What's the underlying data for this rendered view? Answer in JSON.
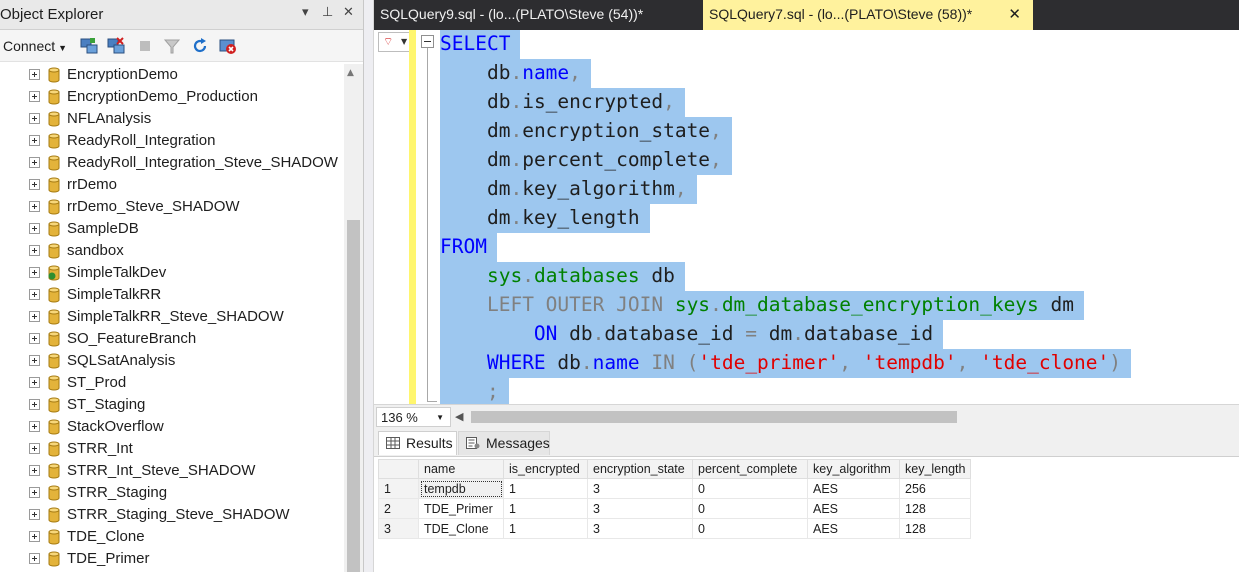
{
  "object_explorer": {
    "title": "Object Explorer",
    "controls": {
      "pin": "▾",
      "autohide": "⊥",
      "close": "✕"
    },
    "toolbar": {
      "connect_label": "Connect",
      "icons": [
        "connect-icon",
        "disconnect-icon",
        "stop-icon",
        "filter-icon",
        "refresh-icon",
        "activity-monitor-icon"
      ]
    },
    "databases": [
      {
        "name": "EncryptionDemo"
      },
      {
        "name": "EncryptionDemo_Production"
      },
      {
        "name": "NFLAnalysis"
      },
      {
        "name": "ReadyRoll_Integration"
      },
      {
        "name": "ReadyRoll_Integration_Steve_SHADOW"
      },
      {
        "name": "rrDemo"
      },
      {
        "name": "rrDemo_Steve_SHADOW"
      },
      {
        "name": "SampleDB"
      },
      {
        "name": "sandbox"
      },
      {
        "name": "SimpleTalkDev",
        "special": true
      },
      {
        "name": "SimpleTalkRR"
      },
      {
        "name": "SimpleTalkRR_Steve_SHADOW"
      },
      {
        "name": "SO_FeatureBranch"
      },
      {
        "name": "SQLSatAnalysis"
      },
      {
        "name": "ST_Prod"
      },
      {
        "name": "ST_Staging"
      },
      {
        "name": "StackOverflow"
      },
      {
        "name": "STRR_Int"
      },
      {
        "name": "STRR_Int_Steve_SHADOW"
      },
      {
        "name": "STRR_Staging"
      },
      {
        "name": "STRR_Staging_Steve_SHADOW"
      },
      {
        "name": "TDE_Clone"
      },
      {
        "name": "TDE_Primer"
      }
    ]
  },
  "tabs": [
    {
      "label": "SQLQuery9.sql - (lo...(PLATO\\Steve (54))*",
      "active": false
    },
    {
      "label": "SQLQuery7.sql - (lo...(PLATO\\Steve (58))*",
      "active": true,
      "close": "✕"
    }
  ],
  "editor": {
    "lines": [
      [
        {
          "t": "SELECT",
          "c": "kw"
        }
      ],
      [
        {
          "t": "    db"
        },
        {
          "t": ".",
          "c": "gr"
        },
        {
          "t": "name",
          "c": "kw"
        },
        {
          "t": ",",
          "c": "gr"
        }
      ],
      [
        {
          "t": "    db"
        },
        {
          "t": ".",
          "c": "gr"
        },
        {
          "t": "is_encrypted"
        },
        {
          "t": ",",
          "c": "gr"
        }
      ],
      [
        {
          "t": "    dm"
        },
        {
          "t": ".",
          "c": "gr"
        },
        {
          "t": "encryption_state"
        },
        {
          "t": ",",
          "c": "gr"
        }
      ],
      [
        {
          "t": "    dm"
        },
        {
          "t": ".",
          "c": "gr"
        },
        {
          "t": "percent_complete"
        },
        {
          "t": ",",
          "c": "gr"
        }
      ],
      [
        {
          "t": "    dm"
        },
        {
          "t": ".",
          "c": "gr"
        },
        {
          "t": "key_algorithm"
        },
        {
          "t": ",",
          "c": "gr"
        }
      ],
      [
        {
          "t": "    dm"
        },
        {
          "t": ".",
          "c": "gr"
        },
        {
          "t": "key_length"
        }
      ],
      [
        {
          "t": "FROM",
          "c": "kw"
        }
      ],
      [
        {
          "t": "    "
        },
        {
          "t": "sys",
          "c": "fn"
        },
        {
          "t": ".",
          "c": "gr"
        },
        {
          "t": "databases",
          "c": "fn"
        },
        {
          "t": " db"
        }
      ],
      [
        {
          "t": "    "
        },
        {
          "t": "LEFT OUTER JOIN",
          "c": "gr"
        },
        {
          "t": " "
        },
        {
          "t": "sys",
          "c": "fn"
        },
        {
          "t": ".",
          "c": "gr"
        },
        {
          "t": "dm_database_encryption_keys",
          "c": "fn"
        },
        {
          "t": " dm"
        }
      ],
      [
        {
          "t": "        "
        },
        {
          "t": "ON",
          "c": "kw"
        },
        {
          "t": " db"
        },
        {
          "t": ".",
          "c": "gr"
        },
        {
          "t": "database_id "
        },
        {
          "t": "=",
          "c": "gr"
        },
        {
          "t": " dm"
        },
        {
          "t": ".",
          "c": "gr"
        },
        {
          "t": "database_id"
        }
      ],
      [
        {
          "t": "    "
        },
        {
          "t": "WHERE",
          "c": "kw"
        },
        {
          "t": " db"
        },
        {
          "t": ".",
          "c": "gr"
        },
        {
          "t": "name",
          "c": "kw"
        },
        {
          "t": " "
        },
        {
          "t": "IN",
          "c": "gr"
        },
        {
          "t": " "
        },
        {
          "t": "(",
          "c": "gr"
        },
        {
          "t": "'tde_primer'",
          "c": "st"
        },
        {
          "t": ", ",
          "c": "gr"
        },
        {
          "t": "'tempdb'",
          "c": "st"
        },
        {
          "t": ", ",
          "c": "gr"
        },
        {
          "t": "'tde_clone'",
          "c": "st"
        },
        {
          "t": ")",
          "c": "gr"
        }
      ],
      [
        {
          "t": "    "
        },
        {
          "t": ";",
          "c": "gr"
        }
      ]
    ]
  },
  "zoom": {
    "value": "136 %"
  },
  "results": {
    "tabs": {
      "results_label": "Results",
      "messages_label": "Messages"
    },
    "columns": [
      "name",
      "is_encrypted",
      "encryption_state",
      "percent_complete",
      "key_algorithm",
      "key_length"
    ],
    "rows": [
      [
        "1",
        "tempdb",
        "1",
        "3",
        "0",
        "AES",
        "256"
      ],
      [
        "2",
        "TDE_Primer",
        "1",
        "3",
        "0",
        "AES",
        "128"
      ],
      [
        "3",
        "TDE_Clone",
        "1",
        "3",
        "0",
        "AES",
        "128"
      ]
    ]
  },
  "colors": {
    "selection": "#9dc7ef",
    "keyword": "#0000ff",
    "function": "#008000",
    "string": "#e00000",
    "operator": "#808080",
    "active_tab": "#fff29d",
    "tab_bar": "#2d2d30"
  }
}
